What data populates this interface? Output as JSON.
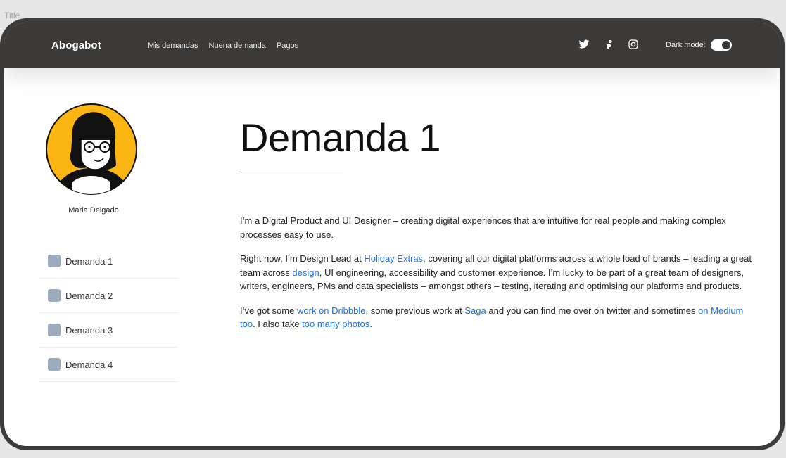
{
  "canvas": {
    "label": "Title"
  },
  "navbar": {
    "brand": "Abogabot",
    "links": [
      "Mis demandas",
      "Nuena demanda",
      "Pagos"
    ],
    "social_icons": [
      "twitter-icon",
      "figma-icon",
      "instagram-icon"
    ],
    "dark_mode_label": "Dark mode:"
  },
  "sidebar": {
    "user_name": "Maria Delgado",
    "items": [
      {
        "label": "Demanda 1"
      },
      {
        "label": "Demanda 2"
      },
      {
        "label": "Demanda 3"
      },
      {
        "label": "Demanda 4"
      }
    ]
  },
  "main": {
    "title": "Demanda 1",
    "p1": "I’m a Digital Product and UI Designer – creating digital experiences that are intuitive for real people and making complex processes easy to use.",
    "p2": {
      "a": "Right now, I’m Design Lead at ",
      "link1": "Holiday Extras",
      "b": ", covering all our digital platforms across a whole load of brands – leading a great team across ",
      "link2": "design",
      "c": ", UI engineering, accessibility and customer experience. I’m lucky to be part of a great team of designers, writers, engineers, PMs and data specialists – amongst others – testing, iterating and optimising our platforms and products."
    },
    "p3": {
      "a": "I’ve got some ",
      "link1": "work on Dribbble",
      "b": ", some previous work at ",
      "link2": "Saga",
      "c": " and you can find me over on twitter and sometimes ",
      "link3": "on Medium too",
      "d": ". I also take ",
      "link4": "too many photos",
      "e": "."
    }
  },
  "colors": {
    "navbar_bg": "#3c3a38",
    "link": "#1a73e8",
    "accent_rule": "#3b7ddd",
    "avatar_bg": "#fbb614",
    "side_icon": "#9cabbe"
  }
}
